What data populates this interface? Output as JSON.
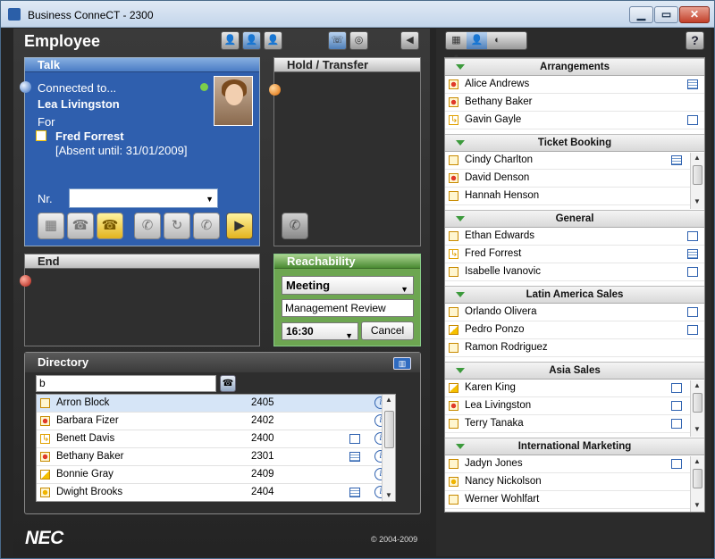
{
  "window": {
    "title": "Business ConneCT - 2300"
  },
  "header": {
    "title": "Employee"
  },
  "talk": {
    "title": "Talk",
    "status": "Connected to...",
    "caller": "Lea Livingston",
    "for_label": "For",
    "for_name": "Fred Forrest",
    "absent_note": "[Absent until: 31/01/2009]",
    "nr_label": "Nr."
  },
  "hold": {
    "title": "Hold / Transfer"
  },
  "end": {
    "title": "End"
  },
  "reachability": {
    "title": "Reachability",
    "status": "Meeting",
    "note": "Management Review",
    "time": "16:30",
    "cancel_label": "Cancel"
  },
  "directory": {
    "title": "Directory",
    "search_value": "b",
    "rows": [
      {
        "name": "Arron Block",
        "number": "2405",
        "info": "i"
      },
      {
        "name": "Barbara Fizer",
        "number": "2402",
        "info": "i"
      },
      {
        "name": "Benett Davis",
        "number": "2400",
        "info": "i"
      },
      {
        "name": "Bethany Baker",
        "number": "2301",
        "info": "i"
      },
      {
        "name": "Bonnie Gray",
        "number": "2409",
        "info": "i"
      },
      {
        "name": "Dwight Brooks",
        "number": "2404",
        "info": "i"
      }
    ]
  },
  "footer": {
    "logo": "NEC",
    "copyright": "© 2004-2009"
  },
  "groups": [
    {
      "name": "Arrangements",
      "members": [
        "Alice Andrews",
        "Bethany Baker",
        "Gavin Gayle"
      ]
    },
    {
      "name": "Ticket Booking",
      "members": [
        "Cindy Charlton",
        "David Denson",
        "Hannah Henson"
      ]
    },
    {
      "name": "General",
      "members": [
        "Ethan Edwards",
        "Fred Forrest",
        "Isabelle Ivanovic"
      ]
    },
    {
      "name": "Latin America Sales",
      "members": [
        "Orlando Olivera",
        "Pedro Ponzo",
        "Ramon Rodriguez"
      ]
    },
    {
      "name": "Asia Sales",
      "members": [
        "Karen King",
        "Lea Livingston",
        "Terry Tanaka"
      ]
    },
    {
      "name": "International Marketing",
      "members": [
        "Jadyn Jones",
        "Nancy Nickolson",
        "Werner Wohlfart"
      ]
    }
  ],
  "help_label": "?"
}
